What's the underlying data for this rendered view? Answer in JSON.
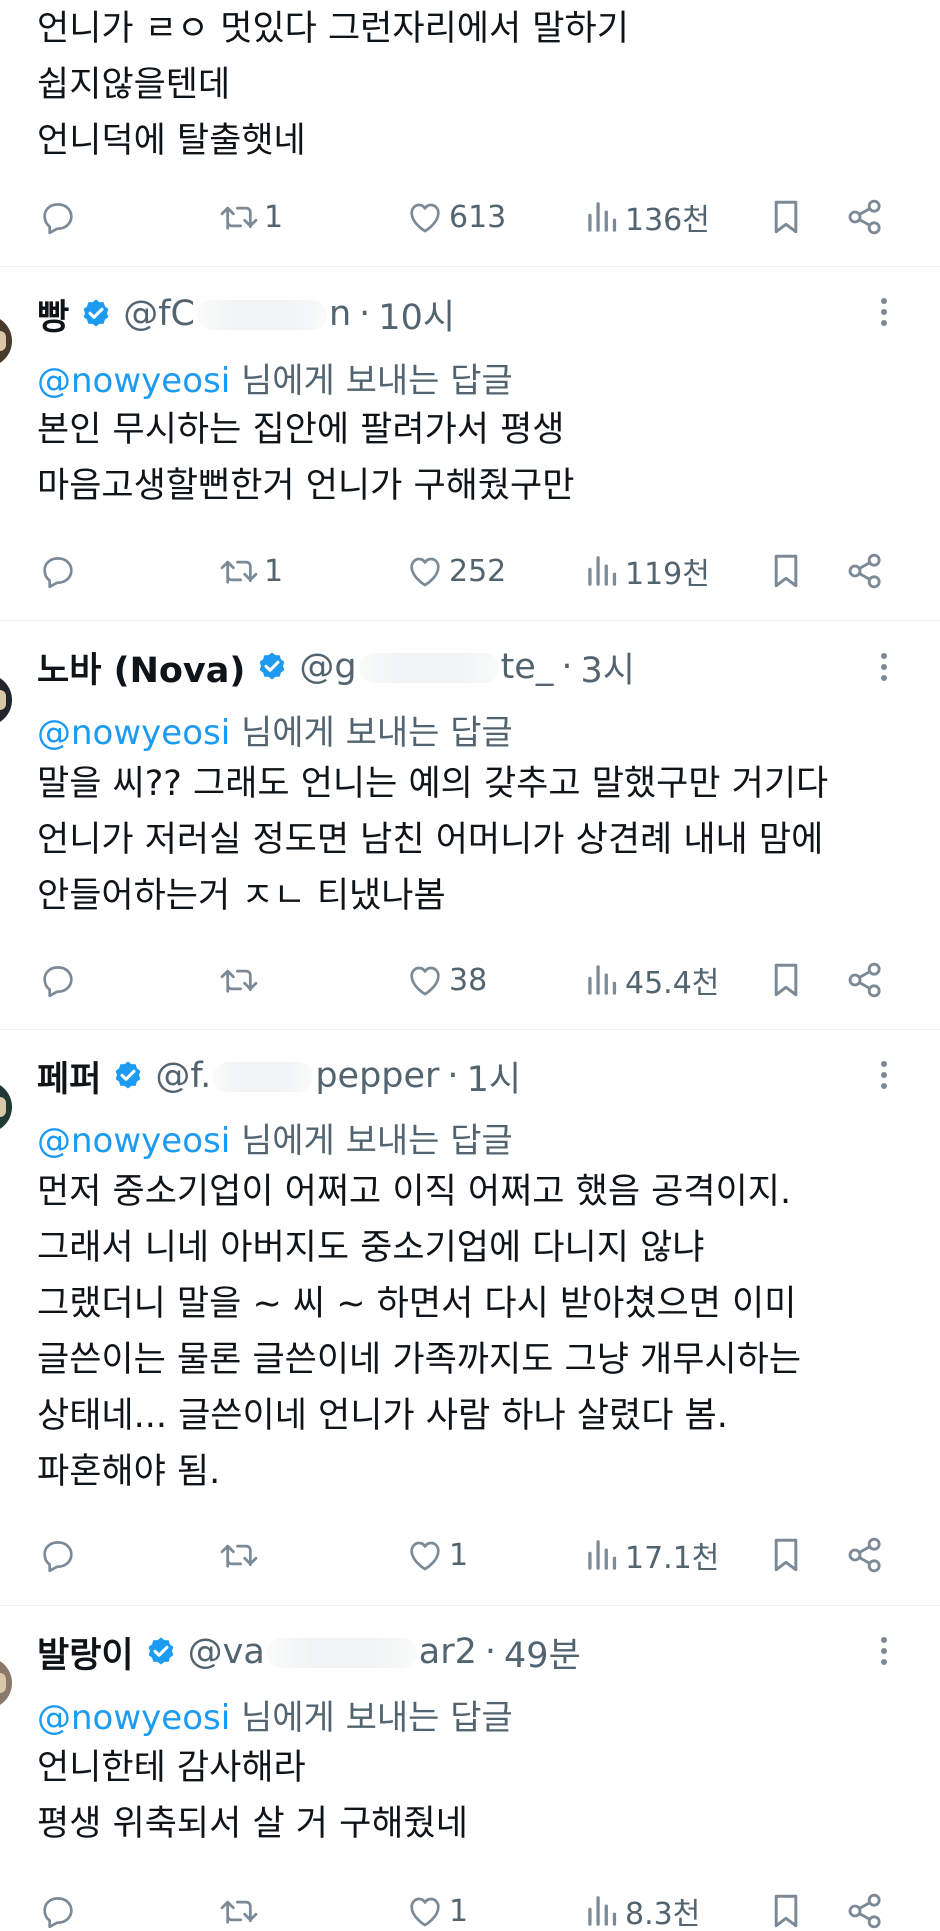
{
  "posts": [
    {
      "name": "",
      "handle": "",
      "time": "",
      "reply_prefix": "",
      "reply_suffix": "",
      "lines": [
        "언니가 ㄹㅇ 멋있다 그런자리에서 말하기",
        "쉽지않을텐데",
        "언니덕에 탈출햇네"
      ],
      "retweets": "1",
      "likes": "613",
      "views": "136천"
    },
    {
      "name": "빵",
      "handle_start": "@fC",
      "handle_end": "n",
      "time": "10시",
      "reply_prefix": "@nowyeosi",
      "reply_suffix": " 님에게 보내는 답글",
      "lines": [
        "본인 무시하는 집안에 팔려가서 평생",
        "마음고생할뻔한거 언니가 구해줬구만"
      ],
      "retweets": "1",
      "likes": "252",
      "views": "119천"
    },
    {
      "name": "노바 (Nova)",
      "handle_start": "@g",
      "handle_end": "te_",
      "time": "3시",
      "reply_prefix": "@nowyeosi",
      "reply_suffix": " 님에게 보내는 답글",
      "lines": [
        "말을 씨?? 그래도 언니는 예의 갖추고 말했구만 거기다",
        "언니가 저러실 정도면 남친 어머니가 상견례 내내 맘에",
        "안들어하는거 ㅈㄴ 티냈나봄"
      ],
      "retweets": "",
      "likes": "38",
      "views": "45.4천"
    },
    {
      "name": "페퍼",
      "handle_start": "@f.",
      "handle_end": "pepper",
      "time": "1시",
      "reply_prefix": "@nowyeosi",
      "reply_suffix": " 님에게 보내는 답글",
      "lines": [
        "먼저 중소기업이 어쩌고 이직 어쩌고 했음 공격이지.",
        "그래서 니네 아버지도 중소기업에 다니지 않냐",
        "그랬더니 말을 ~ 씨 ~ 하면서 다시 받아쳤으면 이미",
        "글쓴이는 물론 글쓴이네 가족까지도 그냥 개무시하는",
        "상태네... 글쓴이네 언니가 사람 하나 살렸다 봄.",
        "파혼해야 됨."
      ],
      "retweets": "",
      "likes": "1",
      "views": "17.1천"
    },
    {
      "name": "발랑이",
      "handle_start": "@va",
      "handle_end": "ar2",
      "time": "49분",
      "reply_prefix": "@nowyeosi",
      "reply_suffix": " 님에게 보내는 답글",
      "lines": [
        "언니한테 감사해라",
        "평생 위축되서 살 거 구해줬네"
      ],
      "retweets": "",
      "likes": "1",
      "views": "8.3천"
    }
  ],
  "colors": {
    "accent": "#1d9bf0",
    "muted": "#536471",
    "divider": "#eff3f4"
  },
  "icons": [
    "reply-icon",
    "retweet-icon",
    "like-icon",
    "views-icon",
    "bookmark-icon",
    "share-icon",
    "verified-badge-icon",
    "more-icon"
  ]
}
